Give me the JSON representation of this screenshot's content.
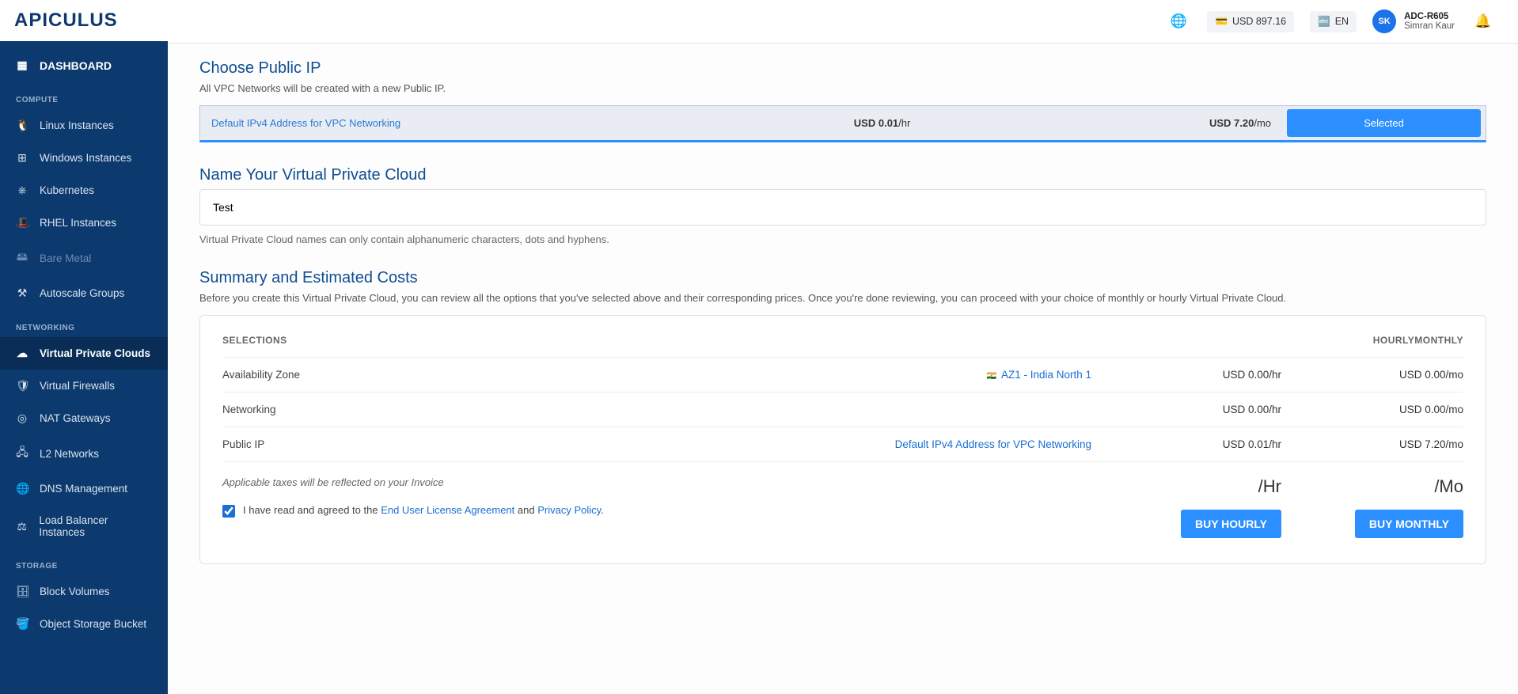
{
  "brand": "APICULUS",
  "topbar": {
    "balance": "USD 897.16",
    "lang": "EN",
    "user_id": "ADC-R605",
    "user_name": "Simran Kaur",
    "avatar_initials": "SK"
  },
  "sidebar": {
    "dashboard": "DASHBOARD",
    "sections": {
      "compute": "COMPUTE",
      "networking": "NETWORKING",
      "storage": "STORAGE"
    },
    "items": {
      "linux": "Linux Instances",
      "windows": "Windows Instances",
      "kubernetes": "Kubernetes",
      "rhel": "RHEL Instances",
      "bare_metal": "Bare Metal",
      "autoscale": "Autoscale Groups",
      "vpc": "Virtual Private Clouds",
      "firewalls": "Virtual Firewalls",
      "nat": "NAT Gateways",
      "l2": "L2 Networks",
      "dns": "DNS Management",
      "lb": "Load Balancer Instances",
      "block": "Block Volumes",
      "object": "Object Storage Bucket"
    }
  },
  "public_ip": {
    "title": "Choose Public IP",
    "subtitle": "All VPC Networks will be created with a new Public IP.",
    "row": {
      "name": "Default IPv4 Address for VPC Networking",
      "hourly_val": "USD 0.01",
      "hourly_unit": "/hr",
      "monthly_val": "USD 7.20",
      "monthly_unit": "/mo",
      "selected_label": "Selected"
    }
  },
  "name_section": {
    "title": "Name Your Virtual Private Cloud",
    "value": "Test",
    "hint": "Virtual Private Cloud names can only contain alphanumeric characters, dots and hyphens."
  },
  "summary": {
    "title": "Summary and Estimated Costs",
    "subtitle": "Before you create this Virtual Private Cloud, you can review all the options that you've selected above and their corresponding prices. Once you're done reviewing, you can proceed with your choice of monthly or hourly Virtual Private Cloud.",
    "headers": {
      "sel": "SELECTIONS",
      "hourly": "HOURLY",
      "monthly": "MONTHLY"
    },
    "rows": [
      {
        "label": "Availability Zone",
        "value": "AZ1 - India North 1",
        "is_link": true,
        "hourly": "USD 0.00/hr",
        "monthly": "USD 0.00/mo"
      },
      {
        "label": "Networking",
        "value": "",
        "is_link": false,
        "hourly": "USD 0.00/hr",
        "monthly": "USD 0.00/mo"
      },
      {
        "label": "Public IP",
        "value": "Default IPv4 Address for VPC Networking",
        "is_link": true,
        "hourly": "USD 0.01/hr",
        "monthly": "USD 7.20/mo"
      }
    ],
    "tax_note": "Applicable taxes will be reflected on your Invoice",
    "agree_prefix": "I have read and agreed to the ",
    "eula": "End User License Agreement",
    "and": " and ",
    "privacy": "Privacy Policy",
    "hourly_unit": "/Hr",
    "monthly_unit": "/Mo",
    "buy_hourly": "BUY HOURLY",
    "buy_monthly": "BUY MONTHLY"
  }
}
